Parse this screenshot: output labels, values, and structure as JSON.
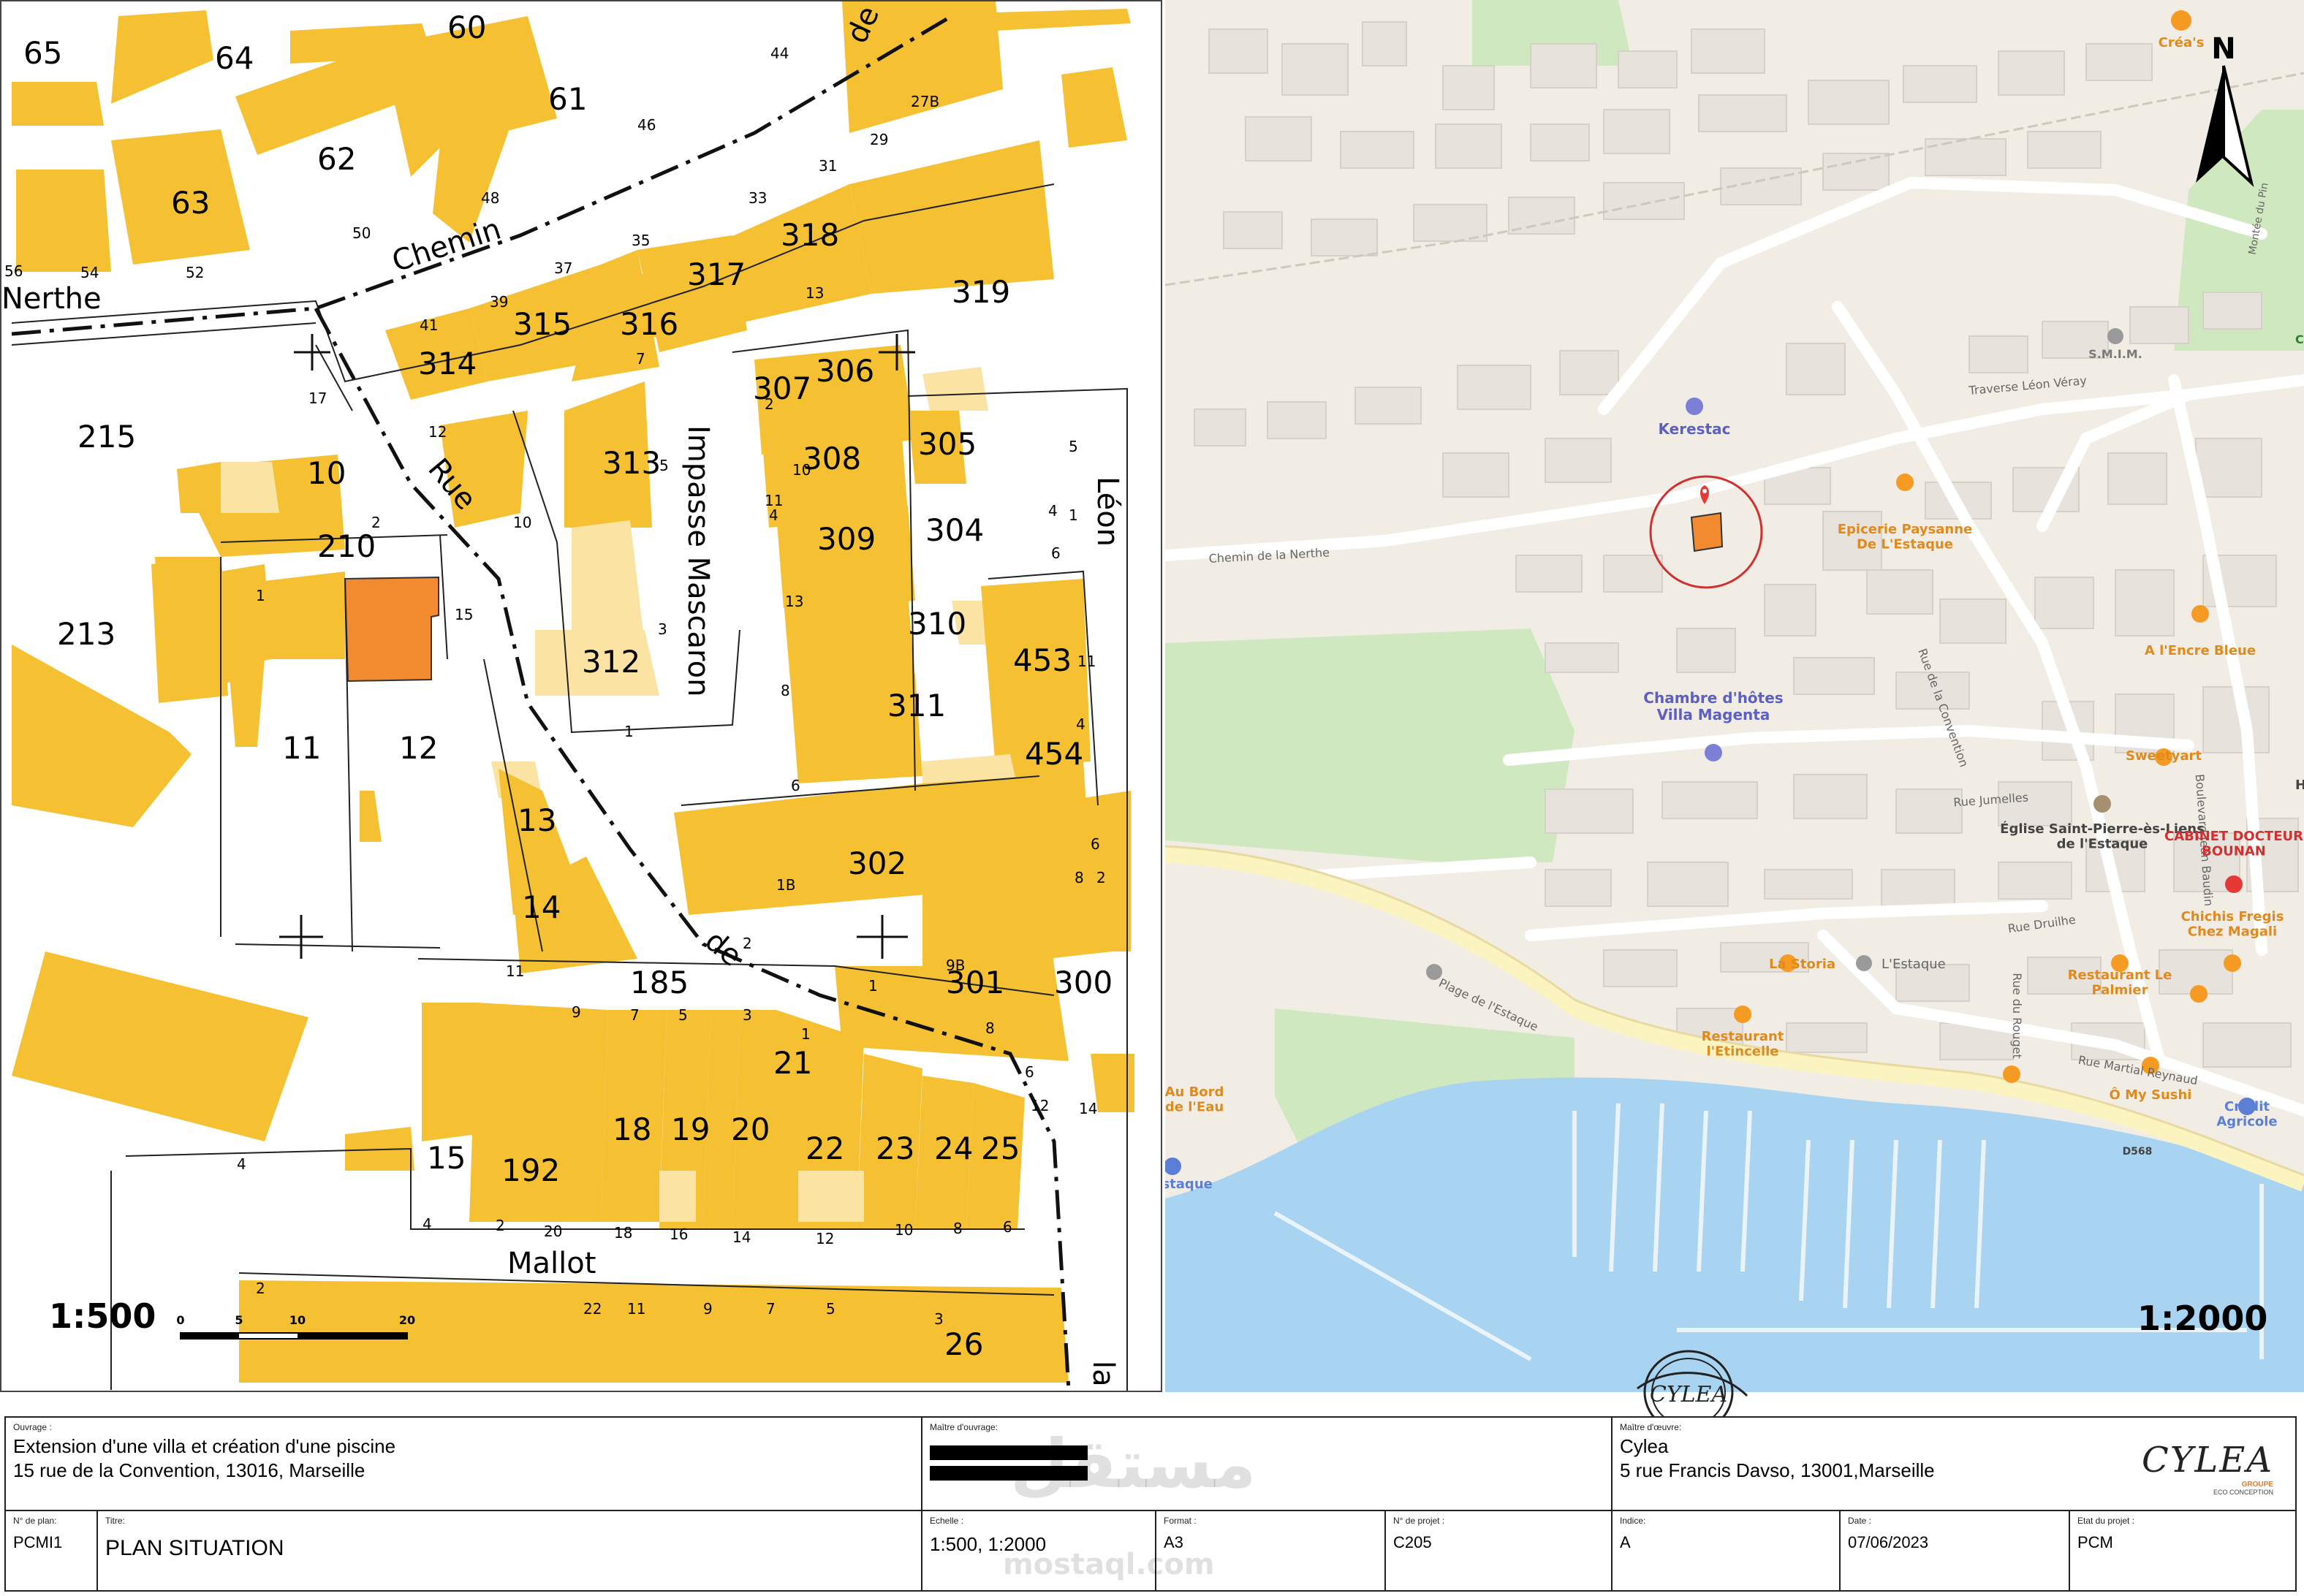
{
  "cadastre": {
    "scale": "1:500",
    "scalebar_ticks": [
      "0",
      "5",
      "10",
      "20"
    ],
    "parcel_numbers": [
      "65",
      "64",
      "60",
      "61",
      "62",
      "63",
      "318",
      "317",
      "316",
      "315",
      "314",
      "319",
      "307",
      "306",
      "305",
      "308",
      "304",
      "309",
      "310",
      "311",
      "312",
      "313",
      "453",
      "454",
      "210",
      "213",
      "215",
      "10",
      "11",
      "12",
      "13",
      "14",
      "185",
      "301",
      "300",
      "302",
      "15",
      "192",
      "18",
      "19",
      "20",
      "21",
      "22",
      "23",
      "24",
      "25",
      "26"
    ],
    "street_labels": [
      "Chemin",
      "de",
      "Nerthe",
      "Rue",
      "Impasse Mascaron",
      "Léon",
      "de",
      "Mallot",
      "la"
    ],
    "house_numbers": [
      "44",
      "46",
      "48",
      "50",
      "52",
      "54",
      "56",
      "41",
      "39",
      "37",
      "35",
      "33",
      "31",
      "29",
      "27B",
      "13",
      "7",
      "12",
      "10",
      "5",
      "3",
      "1",
      "2",
      "4",
      "1",
      "17",
      "15",
      "2",
      "11",
      "9",
      "7",
      "5",
      "3",
      "1",
      "9B",
      "8",
      "6",
      "4",
      "2",
      "20",
      "18",
      "16",
      "14",
      "12",
      "10",
      "8",
      "6",
      "4",
      "2",
      "22",
      "11",
      "9",
      "7",
      "5",
      "3",
      "1",
      "1B",
      "6",
      "8",
      "13",
      "11",
      "2",
      "4",
      "6",
      "8",
      "10",
      "12",
      "14",
      "6",
      "4",
      "2",
      "5",
      "1",
      "11",
      "9",
      "7"
    ]
  },
  "plan": {
    "scale": "1:2000",
    "north": "N",
    "labels": [
      "Créa's",
      "S.M.I.M.",
      "Kerestac",
      "Traverse Léon Véray",
      "Chemin de la Nerthe",
      "Epicerie Paysanne De L'Estaque",
      "Montée du Pin",
      "A l'Encre Bleue",
      "Chambre d'hôtes Villa Magenta",
      "Rue de la Convention",
      "Sweetyart",
      "Boulevard Jean Baudin",
      "Rue Jumelles",
      "Église Saint-Pierre-ès-Liens de l'Estaque",
      "CABINET DOCTEUR BOUNAN",
      "Rue Druilhe",
      "Chichis Fregis Chez Magali",
      "La Storia",
      "L'Estaque",
      "Restaurant Le Palmier",
      "Rue du Rouget",
      "Plage de l'Estaque",
      "Restaurant l'Etincelle",
      "Rue Martial Reynaud",
      "Au Bord de l'Eau",
      "Ô My Sushi",
      "Crédit Agricole",
      "D568",
      "Estaque",
      "Ha",
      "Ch"
    ]
  },
  "titleblock": {
    "ouvrage_caption": "Ouvrage :",
    "ouvrage_line1": "Extension d'une villa et création d'une piscine",
    "ouvrage_line2": "15 rue de la Convention, 13016, Marseille",
    "maitre_ouvrage_caption": "Maître d'ouvrage:",
    "maitre_oeuvre_caption": "Maître d'œuvre:",
    "maitre_oeuvre_name": "Cylea",
    "maitre_oeuvre_address": "5 rue Francis Davso, 13001,Marseille",
    "logo_text": "CYLEA",
    "logo_sub": "GROUPE",
    "logo_sub2": "ECO CONCEPTION",
    "stamp_text": "CYLEA",
    "watermark": "مستقل",
    "watermark_url": "mostaql.com",
    "plan_no_caption": "N° de plan:",
    "plan_no": "PCMI1",
    "titre_caption": "Titre:",
    "titre": "PLAN SITUATION",
    "echelle_caption": "Echelle :",
    "echelle": "1:500, 1:2000",
    "format_caption": "Format :",
    "format": "A3",
    "projet_caption": "N° de projet :",
    "projet": "C205",
    "indice_caption": "Indice:",
    "indice": "A",
    "date_caption": "Date :",
    "date": "07/06/2023",
    "etat_caption": "Etat du projet :",
    "etat": "PCM"
  },
  "colors": {
    "building": "#f6c033",
    "building_light": "#fbe3a4",
    "subject_parcel": "#f28a30",
    "water": "#a8d4f2",
    "land": "#f2ede4",
    "green": "#cfe8c0",
    "road_main": "#fbf3c0",
    "marker": "#e53935"
  }
}
